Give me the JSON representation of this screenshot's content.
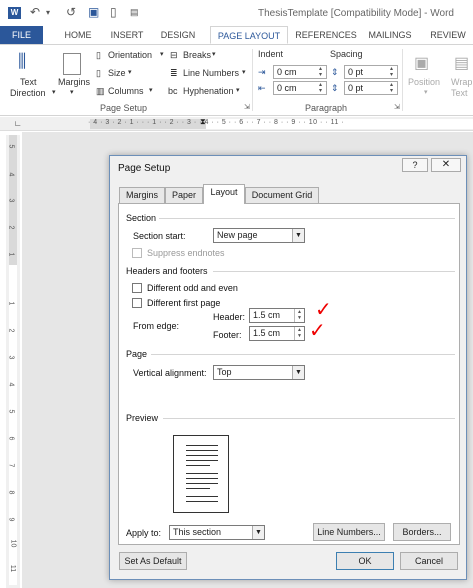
{
  "titlebar": {
    "app_icon": "W",
    "title": "ThesisTemplate [Compatibility Mode] - Word"
  },
  "ribbon_tabs": {
    "file": "FILE",
    "home": "HOME",
    "insert": "INSERT",
    "design": "DESIGN",
    "page_layout": "PAGE LAYOUT",
    "references": "REFERENCES",
    "mailings": "MAILINGS",
    "review": "REVIEW"
  },
  "ribbon": {
    "text_direction": "Text",
    "text_direction_2": "Direction",
    "margins": "Margins",
    "orientation": "Orientation",
    "size": "Size",
    "columns": "Columns",
    "breaks": "Breaks",
    "line_numbers": "Line Numbers",
    "hyphenation": "Hyphenation",
    "page_setup_group": "Page Setup",
    "indent": "Indent",
    "spacing": "Spacing",
    "indent_left": "0 cm",
    "indent_right": "0 cm",
    "spacing_before": "0 pt",
    "spacing_after": "0 pt",
    "paragraph_group": "Paragraph",
    "position": "Position",
    "wrap_text": "Wrap",
    "wrap_text_2": "Text"
  },
  "ruler": {
    "numbers": "· 4 · 3 · 2 · 1 · · · 1 · · 2 · · 3 · · 4 · · 5 · · 6 · · 7 · · 8 · · 9 · · 10 · · 11 ·",
    "v_numbers": [
      "5",
      "4",
      "3",
      "2",
      "1",
      "1",
      "2",
      "3",
      "4",
      "5",
      "6",
      "7",
      "8",
      "9",
      "10",
      "11"
    ]
  },
  "dialog": {
    "title": "Page Setup",
    "help": "?",
    "close": "✕",
    "tabs": [
      "Margins",
      "Paper",
      "Layout",
      "Document Grid"
    ],
    "active_tab": "Layout",
    "section_heading": "Section",
    "section_start_label": "Section start:",
    "section_start_value": "New page",
    "suppress_endnotes": "Suppress endnotes",
    "headers_footers_heading": "Headers and footers",
    "different_odd_even": "Different odd and even",
    "different_first_page": "Different first page",
    "from_edge_label": "From edge:",
    "header_label": "Header:",
    "header_value": "1.5 cm",
    "footer_label": "Footer:",
    "footer_value": "1.5 cm",
    "page_heading": "Page",
    "vertical_alignment_label": "Vertical alignment:",
    "vertical_alignment_value": "Top",
    "preview_heading": "Preview",
    "apply_to_label": "Apply to:",
    "apply_to_value": "This section",
    "line_numbers_button": "Line Numbers...",
    "borders_button": "Borders...",
    "set_as_default": "Set As Default",
    "ok": "OK",
    "cancel": "Cancel"
  },
  "colors": {
    "accent": "#2b579a",
    "annotation": "#e00000"
  }
}
